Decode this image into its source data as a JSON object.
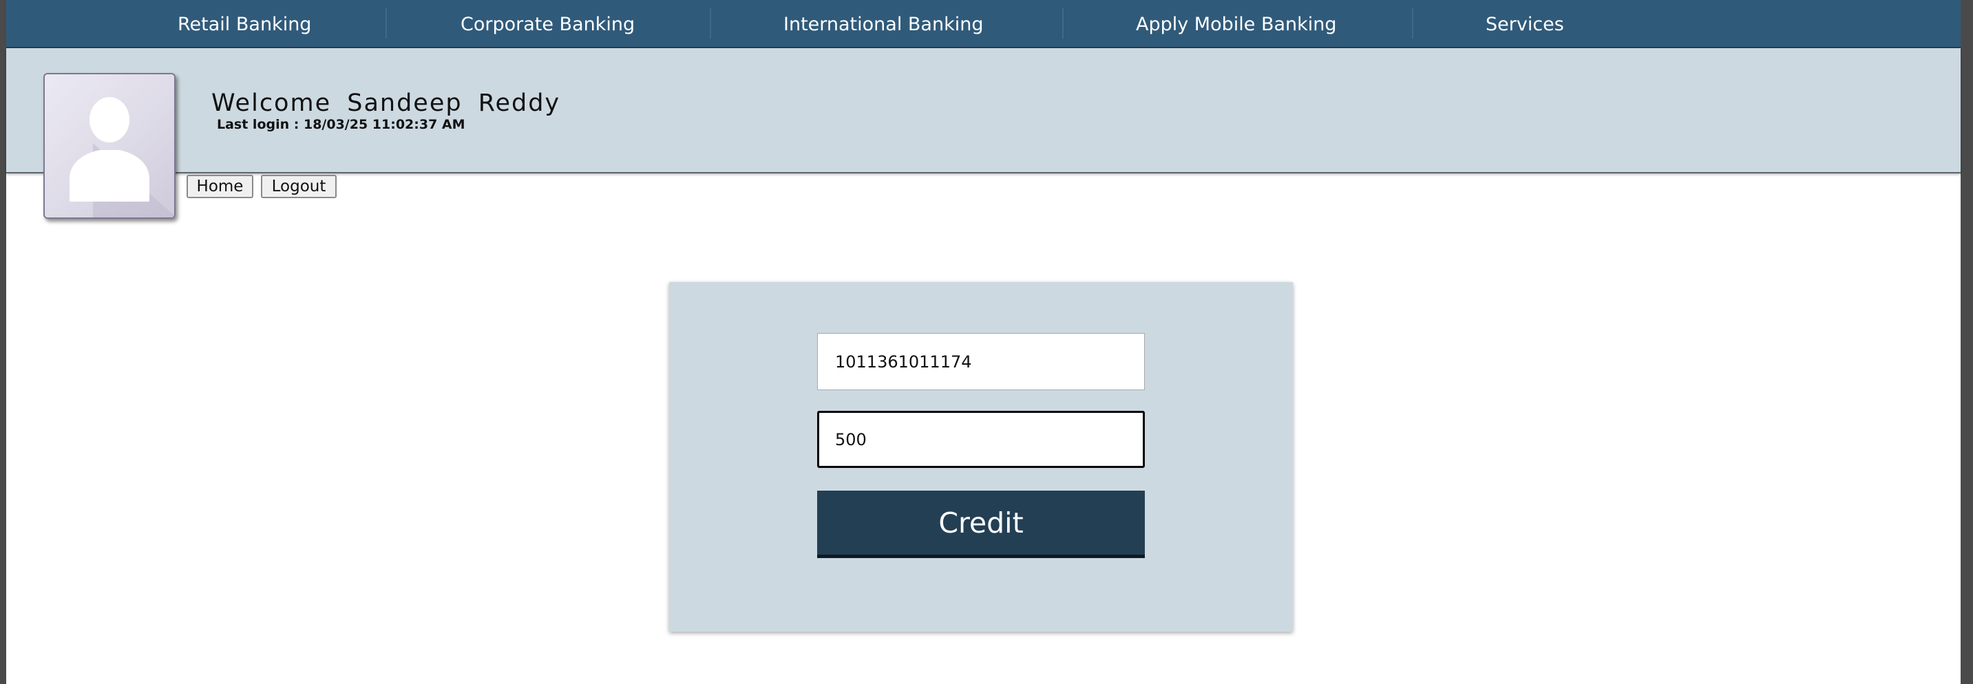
{
  "nav": {
    "items": [
      {
        "label": "Retail Banking"
      },
      {
        "label": "Corporate Banking"
      },
      {
        "label": "International Banking"
      },
      {
        "label": "Apply Mobile Banking"
      },
      {
        "label": "Services"
      }
    ]
  },
  "header": {
    "avatar_icon": "user-avatar-icon",
    "welcome": "Welcome  Sandeep  Reddy",
    "last_login": "Last login : 18/03/25 11:02:37 AM"
  },
  "actions": {
    "home_label": "Home",
    "logout_label": "Logout"
  },
  "form": {
    "account_value": "1011361011174",
    "amount_value": "500",
    "submit_label": "Credit"
  },
  "colors": {
    "nav_bg": "#305a7a",
    "panel_bg": "#cdd9e1",
    "button_bg": "#233f54"
  }
}
